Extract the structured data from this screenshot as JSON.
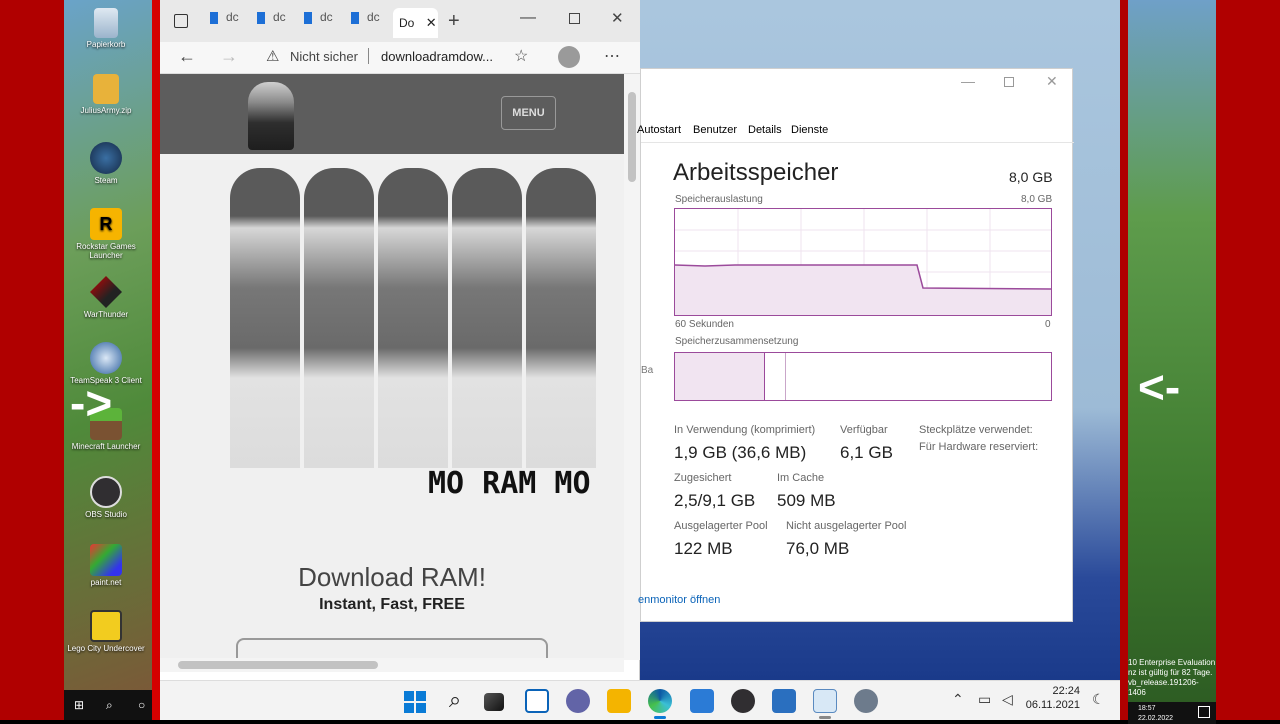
{
  "desktop_icons": [
    {
      "label": "Papierkorb"
    },
    {
      "label": "JuliusArmy.zip"
    },
    {
      "label": "Steam"
    },
    {
      "label": "Rockstar Games Launcher"
    },
    {
      "label": "WarThunder"
    },
    {
      "label": "TeamSpeak 3 Client"
    },
    {
      "label": "Minecraft Launcher"
    },
    {
      "label": "OBS Studio"
    },
    {
      "label": "paint.net"
    },
    {
      "label": "Lego City Undercover"
    }
  ],
  "overlay": {
    "left_arrow": "->",
    "right_arrow": "<-"
  },
  "right_desktop_text": {
    "line1": "10 Enterprise Evaluation",
    "line2": "nz ist gültig für 82 Tage.",
    "line3": "vb_release.191206-1406",
    "time": "18:57",
    "date": "22.02.2022"
  },
  "browser": {
    "tabs": [
      {
        "label": "dc"
      },
      {
        "label": "dc"
      },
      {
        "label": "dc"
      },
      {
        "label": "dc"
      },
      {
        "label": "dc"
      },
      {
        "label": "Do"
      }
    ],
    "security_label": "Nicht sicher",
    "url": "downloadramdow...",
    "site": {
      "menu_label": "MENU",
      "banner_text": "MO  RAM  MO",
      "headline": "Download RAM!",
      "subheadline": "Instant, Fast, FREE"
    }
  },
  "task_manager": {
    "tabs": [
      "Autostart",
      "Benutzer",
      "Details",
      "Dienste"
    ],
    "title": "Arbeitsspeicher",
    "total": "8,0 GB",
    "usage_label": "Speicherauslastung",
    "usage_max": "8,0 GB",
    "time_left": "60 Sekunden",
    "time_right": "0",
    "composition_label": "Speicherzusammensetzung",
    "stats": {
      "in_use_label": "In Verwendung (komprimiert)",
      "in_use_value": "1,9 GB (36,6 MB)",
      "available_label": "Verfügbar",
      "available_value": "6,1 GB",
      "slots_label": "Steckplätze verwendet:",
      "hw_reserved_label": "Für Hardware reserviert:",
      "committed_label": "Zugesichert",
      "committed_value": "2,5/9,1 GB",
      "cached_label": "Im Cache",
      "cached_value": "509 MB",
      "paged_label": "Ausgelagerter Pool",
      "paged_value": "122 MB",
      "nonpaged_label": "Nicht ausgelagerter Pool",
      "nonpaged_value": "76,0 MB"
    },
    "resource_monitor_link": "enmonitor öffnen",
    "side_fragment": "Ba"
  },
  "taskbar": {
    "time": "22:24",
    "date": "06.11.2021"
  },
  "colors": {
    "red_frame": "#b00000",
    "memory_purple": "#9b4a9b",
    "edge_accent": "#0a7bd6"
  }
}
